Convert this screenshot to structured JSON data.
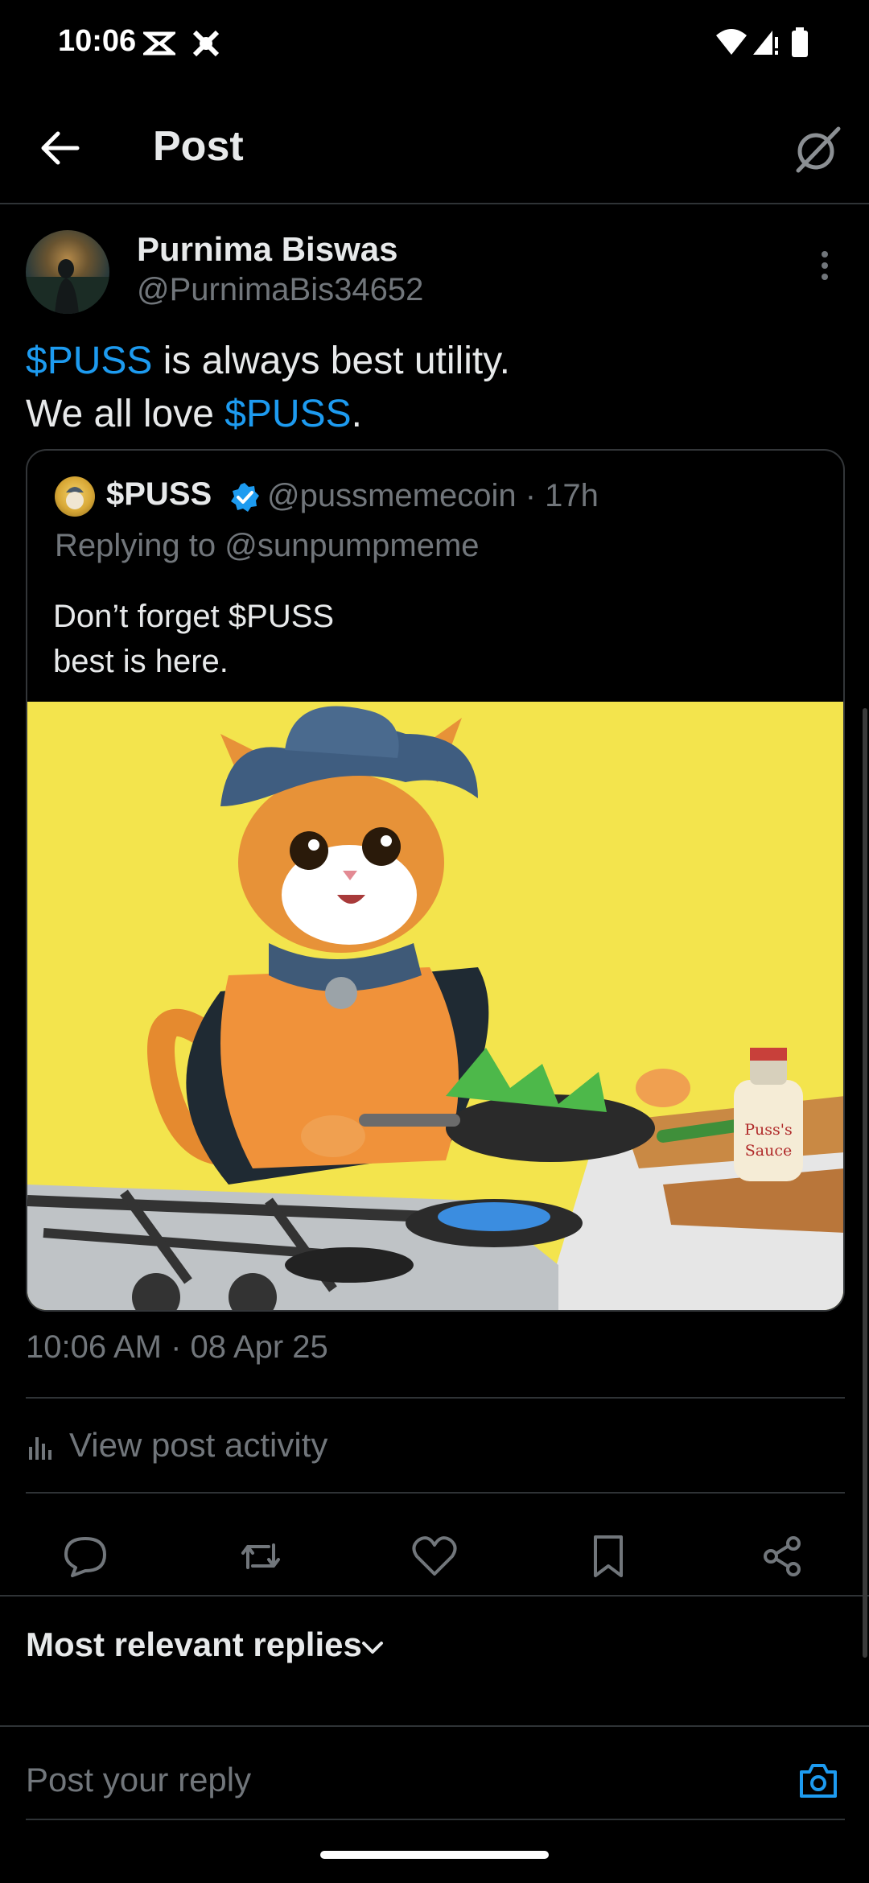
{
  "status_bar": {
    "time": "10:06"
  },
  "header": {
    "title": "Post"
  },
  "post": {
    "author_name": "Purnima Biswas",
    "author_handle": "@PurnimaBis34652",
    "text_line1_tag": "$PUSS",
    "text_line1_rest": " is always best utility.",
    "text_line2_pre": "We all love ",
    "text_line2_tag": "$PUSS",
    "text_line2_post": ".",
    "timestamp": "10:06 AM · 08 Apr 25"
  },
  "quoted": {
    "name": "$PUSS",
    "handle_time": "@pussmemecoin · 17h",
    "replying": "Replying to @sunpumpmeme",
    "text_line1": "Don’t forget $PUSS",
    "text_line2": "best is here.",
    "image_text_line1": "Puss's",
    "image_text_line2": "Sauce"
  },
  "activity": {
    "label": "View post activity"
  },
  "replies": {
    "sort_label": "Most relevant replies",
    "input_placeholder": "Post your reply"
  },
  "colors": {
    "accent": "#1d9bf0",
    "muted": "#71767b",
    "bg": "#000000"
  }
}
